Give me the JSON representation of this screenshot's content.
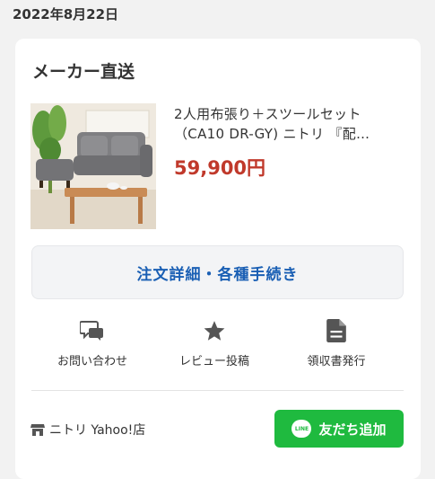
{
  "order_date": "2022年8月22日",
  "card": {
    "title": "メーカー直送",
    "product": {
      "name": "2人用布張り＋スツールセット（CA10 DR-GY) ニトリ 『配…",
      "price": "59,900円",
      "image_icon": "sofa-product-photo"
    },
    "order_button_label": "注文詳細・各種手続き",
    "actions": [
      {
        "label": "お問い合わせ",
        "icon": "chat-bubbles-icon"
      },
      {
        "label": "レビュー投稿",
        "icon": "star-icon"
      },
      {
        "label": "領収書発行",
        "icon": "document-icon"
      }
    ],
    "shop": {
      "name": "ニトリ Yahoo!店",
      "icon": "store-icon"
    },
    "line_button": {
      "label": "友だち追加",
      "badge": "LINE",
      "icon": "line-logo-icon"
    }
  },
  "colors": {
    "price": "#c0392b",
    "link_blue": "#1a5fb4",
    "line_green": "#1fba3f"
  }
}
